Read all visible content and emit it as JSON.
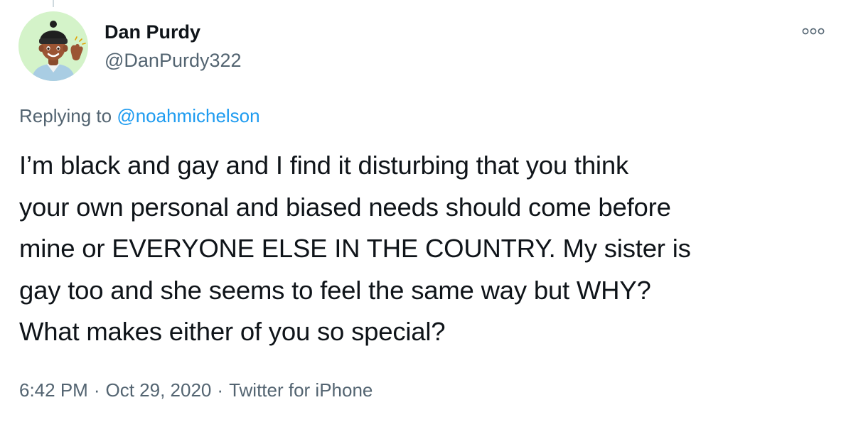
{
  "author": {
    "display_name": "Dan Purdy",
    "handle": "@DanPurdy322",
    "avatar_icon": "memoji-avatar-icon"
  },
  "more_icon": "more-options-icon",
  "reply": {
    "prefix": "Replying to",
    "mention": "@noahmichelson"
  },
  "tweet": {
    "lines": [
      "I’m black and gay and I find it disturbing that you think",
      "your own personal and biased needs should come before",
      "mine or EVERYONE ELSE IN THE COUNTRY. My sister is",
      "gay too and she seems to feel the same way but WHY?",
      "What makes either of you so special?"
    ]
  },
  "meta": {
    "time": "6:42 PM",
    "date": "Oct 29, 2020",
    "source": "Twitter for iPhone",
    "separator": "·"
  },
  "colors": {
    "text": "#0f1419",
    "secondary": "#536471",
    "link": "#1d9bf0",
    "avatar_bg": "#d4f3c9"
  }
}
